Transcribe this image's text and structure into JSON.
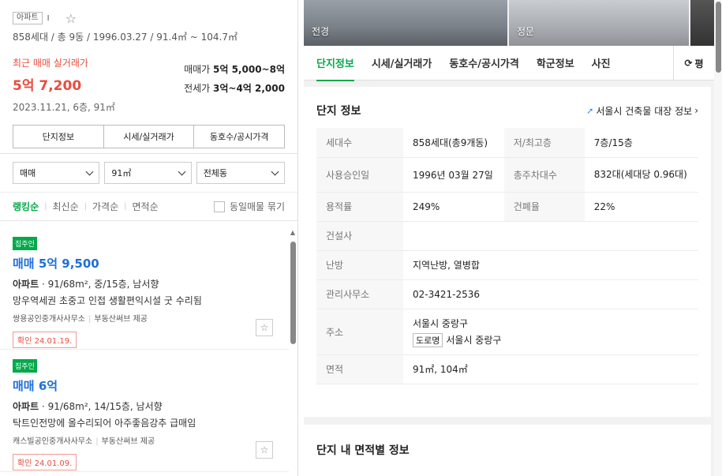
{
  "complex": {
    "type_badge": "아파트",
    "name_fragment": "I",
    "meta": "858세대 / 총 9동 / 1996.03.27 / 91.4㎡ ~ 104.7㎡"
  },
  "recent": {
    "label": "최근 매매 실거래가",
    "price": "5억 7,200",
    "date": "2023.11.21, 6층, 91㎡"
  },
  "ranges": {
    "sale_label": "매매가",
    "sale_value": "5억 5,000~8억",
    "lease_label": "전세가",
    "lease_value": "3억~4억 2,000"
  },
  "left_tabs": [
    "단지정보",
    "시세/실거래가",
    "동호수/공시가격"
  ],
  "filters": {
    "deal_type": "매매",
    "area": "91㎡",
    "building": "전체동"
  },
  "sort": {
    "options": [
      "랭킹순",
      "최신순",
      "가격순",
      "면적순"
    ],
    "active": "랭킹순",
    "group_label": "동일매물 묶기"
  },
  "listings": [
    {
      "badge": "집주인",
      "price": "매매 5억 9,500",
      "spec_type": "아파트",
      "spec": " · 91/68m², 중/15층, 남서향",
      "desc": "망우역세권 초중고 인접 생활편익시설 굿 수리됨",
      "agent": "쌍용공인중개사사무소",
      "provider": "부동산써브 제공",
      "confirm": "확인 24.01.19."
    },
    {
      "badge": "집주인",
      "price": "매매 6억",
      "spec_type": "아파트",
      "spec": " · 91/68m², 14/15층, 남서향",
      "desc": "탁트인전망에 올수리되어 아주좋음강추 급매임",
      "agent": "캐스빌공인중개사사무소",
      "provider": "부동산써브 제공",
      "confirm": "확인 24.01.09."
    }
  ],
  "photos": {
    "caption1": "전경",
    "caption2": "정문"
  },
  "right_tabs": [
    "단지정보",
    "시세/실거래가",
    "동호수/공시가격",
    "학군정보",
    "사진"
  ],
  "right_tab_active": "단지정보",
  "more_tab_label": "평",
  "info_card": {
    "title": "단지 정보",
    "link": "서울시 건축물 대장 정보",
    "rows": {
      "households_key": "세대수",
      "households_val": "858세대(총9개동)",
      "floors_key": "저/최고층",
      "floors_val": "7층/15층",
      "approval_key": "사용승인일",
      "approval_val": "1996년 03월 27일",
      "parking_key": "총주차대수",
      "parking_val": "832대(세대당 0.96대)",
      "far_key": "용적률",
      "far_val": "249%",
      "bcr_key": "건폐율",
      "bcr_val": "22%",
      "builder_key": "건설사",
      "builder_val": "",
      "heating_key": "난방",
      "heating_val": "지역난방, 열병합",
      "office_key": "관리사무소",
      "office_val": "02-3421-2536",
      "address_key": "주소",
      "address_val": "서울시 중랑구",
      "road_tag": "도로명",
      "road_val": "서울시 중랑구",
      "area_key": "면적",
      "area_val": "91㎡, 104㎡"
    }
  },
  "area_card": {
    "title": "단지 내 면적별 정보"
  },
  "colors": {
    "brand_green": "#03a94a",
    "price_red": "#e84c3d",
    "listing_blue": "#1e6fd9"
  }
}
